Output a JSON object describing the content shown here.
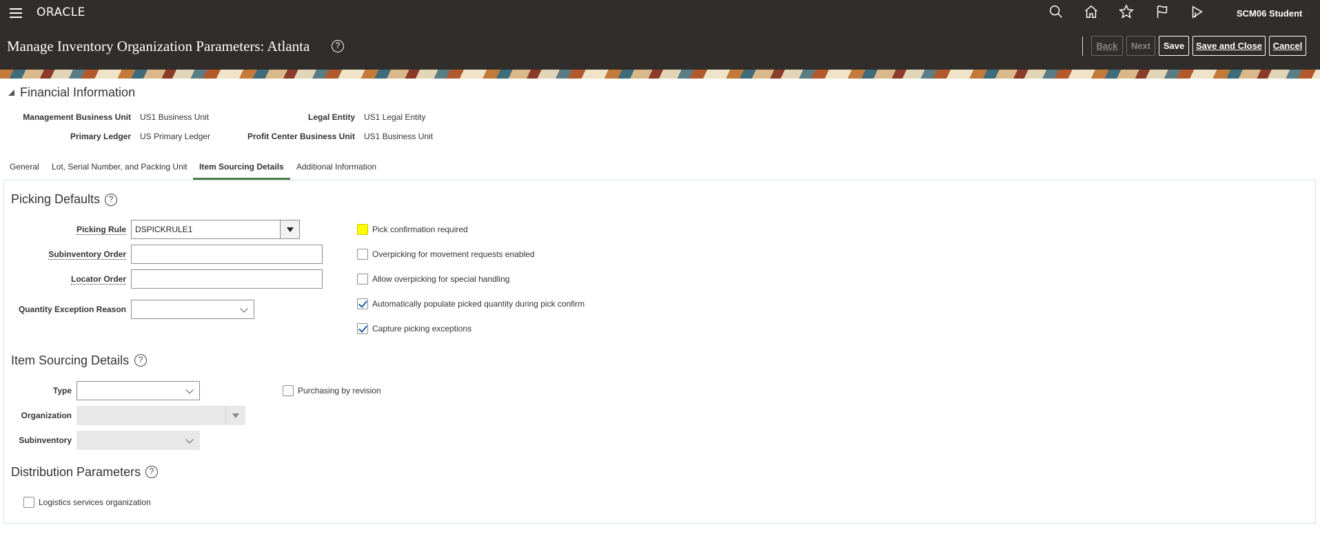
{
  "header": {
    "logo": "ORACLE",
    "user": "SCM06 Student",
    "page_title": "Manage Inventory Organization Parameters: Atlanta",
    "icons": [
      "search-icon",
      "home-icon",
      "star-icon",
      "flag-icon",
      "notifications-icon"
    ],
    "buttons": {
      "back": "Back",
      "next": "Next",
      "save": "Save",
      "save_close": "Save and Close",
      "cancel": "Cancel"
    }
  },
  "financial": {
    "title": "Financial Information",
    "management_bu_label": "Management Business Unit",
    "management_bu_value": "US1 Business Unit",
    "primary_ledger_label": "Primary Ledger",
    "primary_ledger_value": "US Primary Ledger",
    "legal_entity_label": "Legal Entity",
    "legal_entity_value": "US1 Legal Entity",
    "profit_center_label": "Profit Center Business Unit",
    "profit_center_value": "US1 Business Unit"
  },
  "tabs": [
    {
      "label": "General",
      "active": false
    },
    {
      "label": "Lot, Serial Number, and Packing Unit",
      "active": false
    },
    {
      "label": "Item Sourcing Details",
      "active": true
    },
    {
      "label": "Additional Information",
      "active": false
    }
  ],
  "picking": {
    "title": "Picking Defaults",
    "picking_rule_label": "Picking Rule",
    "picking_rule_value": "DSPICKRULE1",
    "subinventory_order_label": "Subinventory Order",
    "subinventory_order_value": "",
    "locator_order_label": "Locator Order",
    "locator_order_value": "",
    "qty_exception_label": "Quantity Exception Reason",
    "qty_exception_value": "",
    "checkboxes": [
      {
        "label": "Pick confirmation required",
        "checked": false
      },
      {
        "label": "Overpicking for movement requests enabled",
        "checked": false
      },
      {
        "label": "Allow overpicking for special handling",
        "checked": false
      },
      {
        "label": "Automatically populate picked quantity during pick confirm",
        "checked": true
      },
      {
        "label": "Capture picking exceptions",
        "checked": true
      }
    ]
  },
  "sourcing": {
    "title": "Item Sourcing Details",
    "type_label": "Type",
    "type_value": "",
    "organization_label": "Organization",
    "organization_value": "",
    "subinventory_label": "Subinventory",
    "subinventory_value": "",
    "purchasing_by_revision_label": "Purchasing by revision",
    "purchasing_by_revision_checked": false
  },
  "distribution": {
    "title": "Distribution Parameters",
    "logistics_label": "Logistics services organization",
    "logistics_checked": false
  },
  "help_glyph": "?"
}
